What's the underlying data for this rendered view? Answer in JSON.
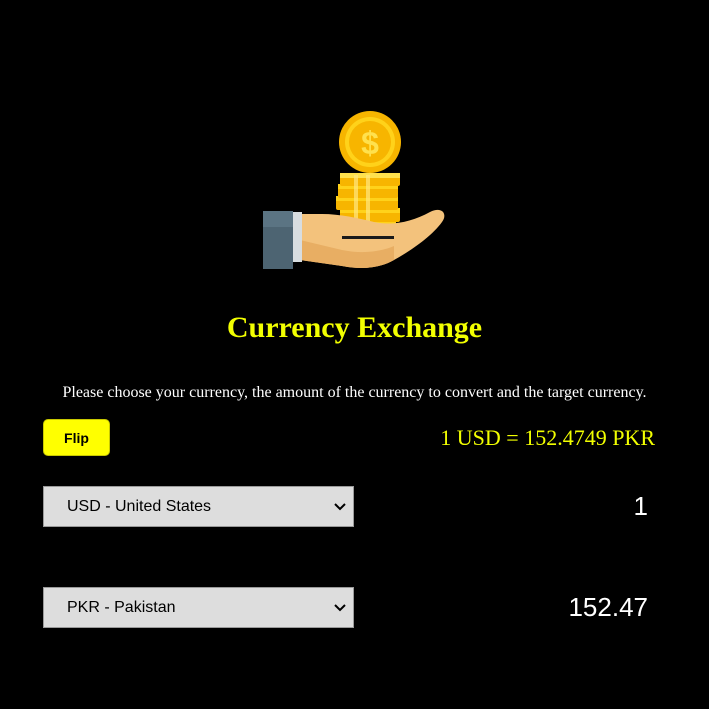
{
  "header": {
    "logo_icon": "hand-holding-coins-icon",
    "title": "Currency Exchange",
    "instructions": "Please choose your currency, the amount of the currency to convert and the target currency."
  },
  "controls": {
    "flip_label": "Flip",
    "rate_text": "1 USD = 152.4749 PKR"
  },
  "from": {
    "currency": "USD - United States",
    "amount": "1"
  },
  "to": {
    "currency": "PKR - Pakistan",
    "amount": "152.47"
  },
  "colors": {
    "background": "#000000",
    "accent": "#f2ff00",
    "button": "#ffff00",
    "select_bg": "#dddddd"
  }
}
